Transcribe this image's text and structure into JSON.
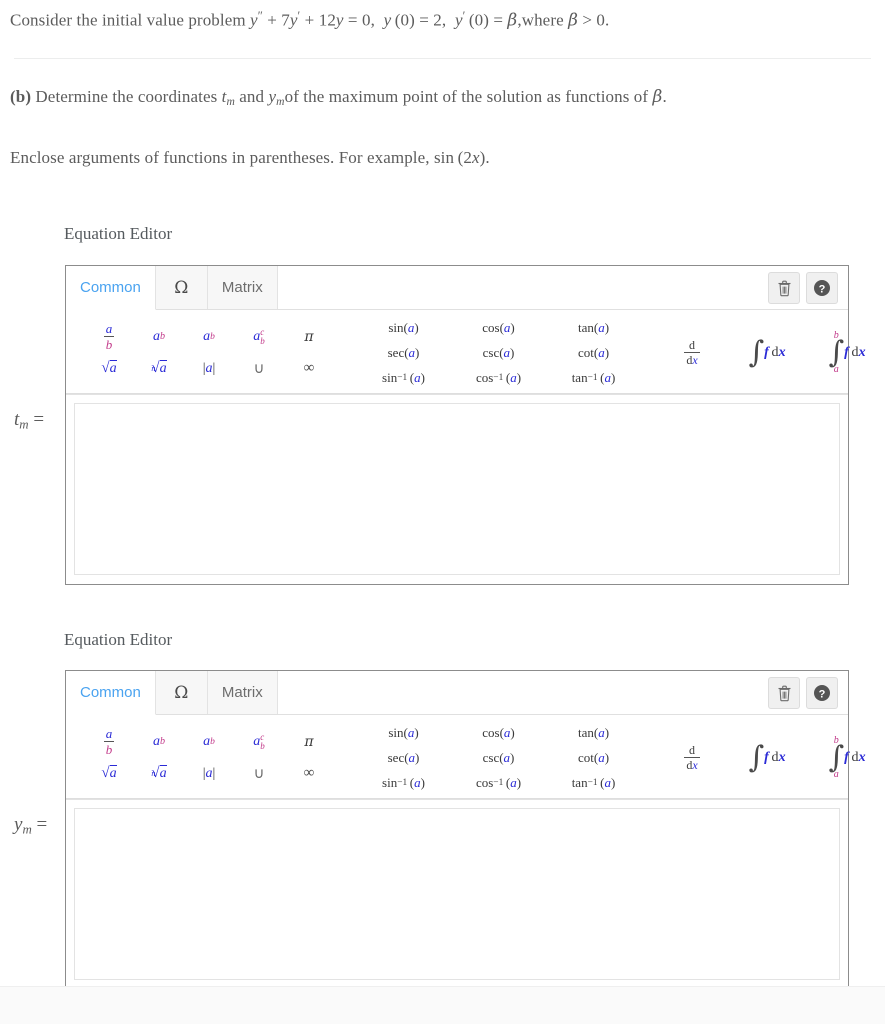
{
  "problem": {
    "line1_pre": "Consider the initial value problem ",
    "line1_eq": "y'' + 7y' + 12y = 0,  y (0) = 2,  y' (0) = β,",
    "line1_post": "where β > 0.",
    "line2_label": "(b)",
    "line2_text": " Determine the coordinates tₘ and yₘ of the maximum point of the solution as functions of β.",
    "line3": "Enclose arguments of functions in parentheses. For example, sin (2x)."
  },
  "editors": [
    {
      "title": "Equation Editor",
      "answer_label": "t_m =",
      "label_var": "t",
      "label_sub": "m",
      "value": "",
      "tabs": [
        {
          "label": "Common",
          "active": true
        },
        {
          "label": "Ω",
          "active": false
        },
        {
          "label": "Matrix",
          "active": false
        }
      ],
      "actions": [
        {
          "name": "trash-icon",
          "title": "Clear"
        },
        {
          "name": "help-icon",
          "title": "Help"
        }
      ]
    },
    {
      "title": "Equation Editor",
      "answer_label": "y_m =",
      "label_var": "y",
      "label_sub": "m",
      "value": "",
      "tabs": [
        {
          "label": "Common",
          "active": true
        },
        {
          "label": "Ω",
          "active": false
        },
        {
          "label": "Matrix",
          "active": false
        }
      ],
      "actions": [
        {
          "name": "trash-icon",
          "title": "Clear"
        },
        {
          "name": "help-icon",
          "title": "Help"
        }
      ]
    }
  ],
  "palette": {
    "basic_row1": [
      "a/b",
      "a^b",
      "a_b",
      "a_b^c",
      "π"
    ],
    "basic_row2": [
      "√a",
      "ⁿ√a",
      "|a|",
      "∪",
      "∞"
    ],
    "trig_row1": [
      "sin(a)",
      "cos(a)",
      "tan(a)"
    ],
    "trig_row2": [
      "sec(a)",
      "csc(a)",
      "cot(a)"
    ],
    "trig_row3": [
      "sin⁻¹ (a)",
      "cos⁻¹ (a)",
      "tan⁻¹ (a)"
    ],
    "calculus": [
      "d/dx",
      "∫ f dx",
      "∫_a^b f dx"
    ],
    "pi": "π",
    "union": "∪",
    "infinity": "∞",
    "var_a": "a",
    "var_b": "b",
    "var_c": "c",
    "var_n": "n",
    "var_f": "f",
    "var_x": "x",
    "d_letter": "d",
    "sin": "sin",
    "cos": "cos",
    "tan": "tan",
    "sec": "sec",
    "csc": "csc",
    "cot": "cot",
    "inv": "−1",
    "lower_a": "a",
    "upper_b": "b"
  },
  "colors": {
    "accent_blue": "#4aa3f0",
    "symbol_blue": "#2b2bd6",
    "symbol_red": "#c23a8a",
    "text_gray": "#5c5c5c",
    "border_gray": "#8c8c8c"
  }
}
